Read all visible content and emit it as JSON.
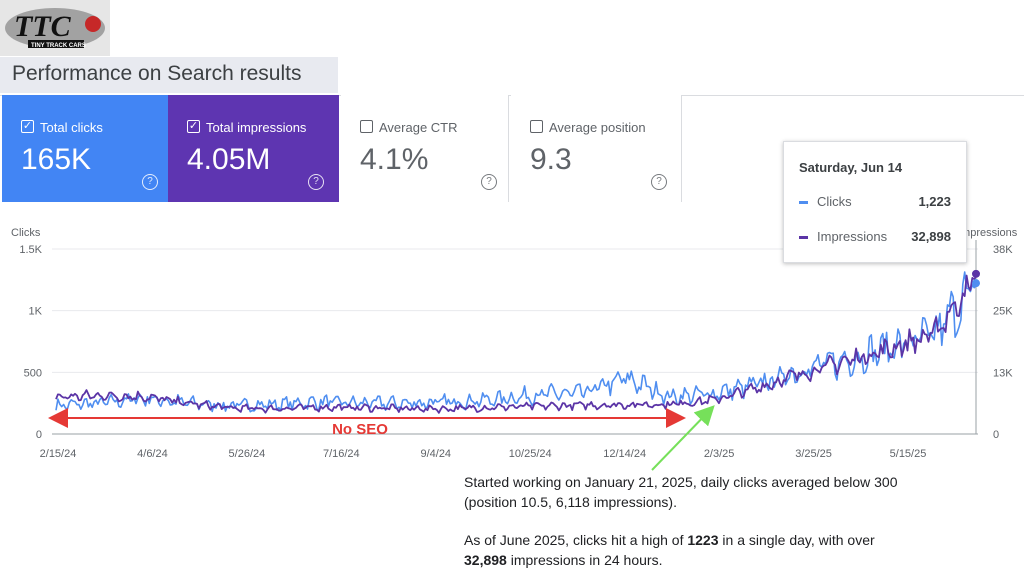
{
  "logo": {
    "text": "TTC",
    "subtext": "TINY TRACK CARS"
  },
  "header": {
    "title": "Performance on Search results"
  },
  "metrics": [
    {
      "label": "Total clicks",
      "value": "165K",
      "checked": true
    },
    {
      "label": "Total impressions",
      "value": "4.05M",
      "checked": true
    },
    {
      "label": "Average CTR",
      "value": "4.1%",
      "checked": false
    },
    {
      "label": "Average position",
      "value": "9.3",
      "checked": false
    }
  ],
  "tooltip": {
    "date": "Saturday, Jun 14",
    "rows": [
      {
        "label": "Clicks",
        "value": "1,223"
      },
      {
        "label": "Impressions",
        "value": "32,898"
      }
    ]
  },
  "annotation": {
    "no_seo": "No SEO"
  },
  "notes": {
    "line1": "Started working on January 21, 2025, daily clicks averaged below 300",
    "line2": "(position 10.5, 6,118 impressions).",
    "line3_pre": "As of June 2025, clicks hit a high of ",
    "line3_bold": "1223",
    "line3_post": " in a single day, with over",
    "line4_bold": "32,898",
    "line4_post": " impressions in 24 hours."
  },
  "colors": {
    "clicks": "#4f8ef0",
    "impressions": "#5b34a6",
    "card_clicks": "#4285f4",
    "card_impressions": "#5e35b1",
    "arrow_red": "#e53935",
    "arrow_green": "#76e05a"
  },
  "chart_data": {
    "type": "line",
    "title": "",
    "ylabel_left": "Clicks",
    "ylabel_right": "Impressions",
    "ylim_left": [
      0,
      1500
    ],
    "ylim_right": [
      0,
      38000
    ],
    "yticks_left": [
      "0",
      "500",
      "1K",
      "1.5K"
    ],
    "yticks_right": [
      "0",
      "13K",
      "25K",
      "38K"
    ],
    "xticks": [
      "2/15/24",
      "4/6/24",
      "5/26/24",
      "7/16/24",
      "9/4/24",
      "10/25/24",
      "12/14/24",
      "2/3/25",
      "3/25/25",
      "5/15/25"
    ],
    "grid": true,
    "x": [
      "2/15/24",
      "3/10/24",
      "4/6/24",
      "5/1/24",
      "5/26/24",
      "6/20/24",
      "7/16/24",
      "8/10/24",
      "9/4/24",
      "9/30/24",
      "10/25/24",
      "11/19/24",
      "12/14/24",
      "1/8/25",
      "1/21/25",
      "2/3/25",
      "2/28/25",
      "3/25/25",
      "4/20/25",
      "5/15/25",
      "6/5/25",
      "6/14/25"
    ],
    "series": [
      {
        "name": "Clicks",
        "values": [
          230,
          250,
          290,
          250,
          230,
          240,
          260,
          250,
          250,
          260,
          280,
          320,
          330,
          450,
          300,
          330,
          400,
          520,
          600,
          700,
          800,
          1223
        ]
      },
      {
        "name": "Impressions",
        "values": [
          7600,
          7900,
          7700,
          6300,
          5300,
          5200,
          5500,
          5400,
          5200,
          5200,
          5500,
          5700,
          5900,
          6000,
          6118,
          7000,
          9500,
          12500,
          15000,
          17500,
          20500,
          32898
        ]
      }
    ]
  }
}
